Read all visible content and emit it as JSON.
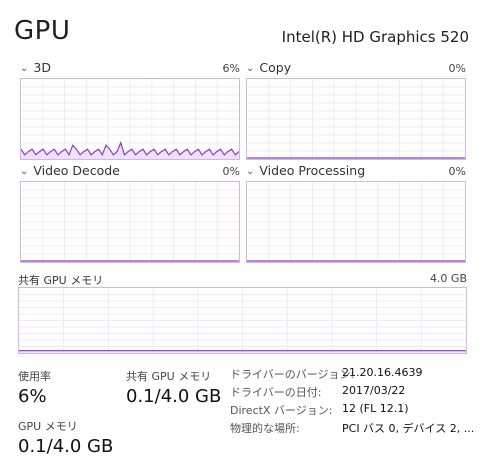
{
  "header": {
    "title": "GPU",
    "gpu_name": "Intel(R) HD Graphics 520"
  },
  "engines": [
    {
      "name": "3D",
      "percent": "6%"
    },
    {
      "name": "Copy",
      "percent": "0%"
    },
    {
      "name": "Video Decode",
      "percent": "0%"
    },
    {
      "name": "Video Processing",
      "percent": "0%"
    }
  ],
  "shared_memory": {
    "label": "共有 GPU メモリ",
    "max": "4.0 GB"
  },
  "stats": {
    "usage_label": "使用率",
    "usage_value": "6%",
    "shared_label": "共有 GPU メモリ",
    "shared_value": "0.1/4.0 GB",
    "gpu_mem_label": "GPU メモリ",
    "gpu_mem_value": "0.1/4.0 GB"
  },
  "details": [
    {
      "label": "ドライバーのバージョン:",
      "value": "21.20.16.4639"
    },
    {
      "label": "ドライバーの日付:",
      "value": "2017/03/22"
    },
    {
      "label": "DirectX バージョン:",
      "value": "12 (FL 12.1)"
    },
    {
      "label": "物理的な場所:",
      "value": "PCI バス 0, デバイス 2, ..."
    }
  ],
  "colors": {
    "accent": "#8b3fbf",
    "graph_border": "#d2b6e8",
    "grid": "#f0e8f6"
  }
}
